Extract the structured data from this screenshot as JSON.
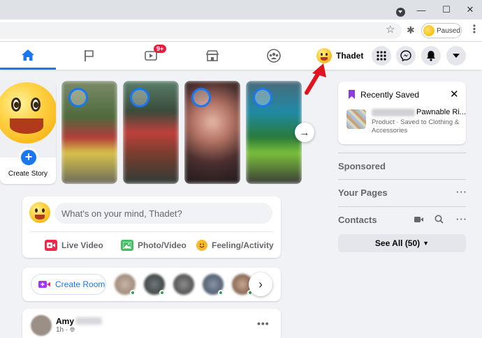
{
  "browser": {
    "profile_status": "Paused"
  },
  "nav": {
    "watch_badge": "9+",
    "profile_name": "Thadet"
  },
  "stories": {
    "create_label": "Create Story"
  },
  "composer": {
    "placeholder": "What's on your mind, Thadet?",
    "live_video": "Live Video",
    "photo_video": "Photo/Video",
    "feeling_activity": "Feeling/Activity"
  },
  "rooms": {
    "create_room": "Create Room"
  },
  "post": {
    "author_first": "Amy",
    "time": "1h ·"
  },
  "right_rail": {
    "recently_saved": {
      "title": "Recently Saved",
      "item_name": "Pawnable Ri...",
      "item_meta": "Product · Saved to Clothing & Accessories"
    },
    "sponsored": "Sponsored",
    "your_pages": "Your Pages",
    "contacts": "Contacts",
    "see_all": "See All (50)"
  },
  "colors": {
    "fb_blue": "#1877f2",
    "badge_red": "#e41e3f",
    "arrow_red": "#e0141e",
    "saved_purple": "#8c3cdd"
  }
}
